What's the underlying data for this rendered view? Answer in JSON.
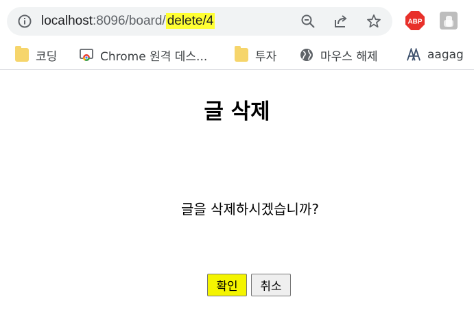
{
  "browser": {
    "url_host": "localhost",
    "url_path": ":8096/board/",
    "url_highlighted": "delete/4",
    "icons": [
      "info-icon",
      "zoom-icon",
      "share-icon",
      "star-icon",
      "adblock-icon",
      "profile-icon"
    ],
    "adblock_label": "ABP"
  },
  "bookmarks": [
    {
      "label": "코딩",
      "icon": "folder-icon"
    },
    {
      "label": "Chrome 원격 데스...",
      "icon": "remote-desktop-icon"
    },
    {
      "label": "투자",
      "icon": "folder-icon"
    },
    {
      "label": "마우스 해제",
      "icon": "globe-icon"
    },
    {
      "label": "aagag",
      "icon": "aagag-icon"
    }
  ],
  "page": {
    "title": "글 삭제",
    "message": "글을 삭제하시겠습니까?",
    "confirm_label": "확인",
    "cancel_label": "취소"
  },
  "colors": {
    "highlight": "#ffff33",
    "confirm_button": "#f4f400",
    "omnibox_bg": "#f1f3f4",
    "folder": "#f6d56b"
  }
}
